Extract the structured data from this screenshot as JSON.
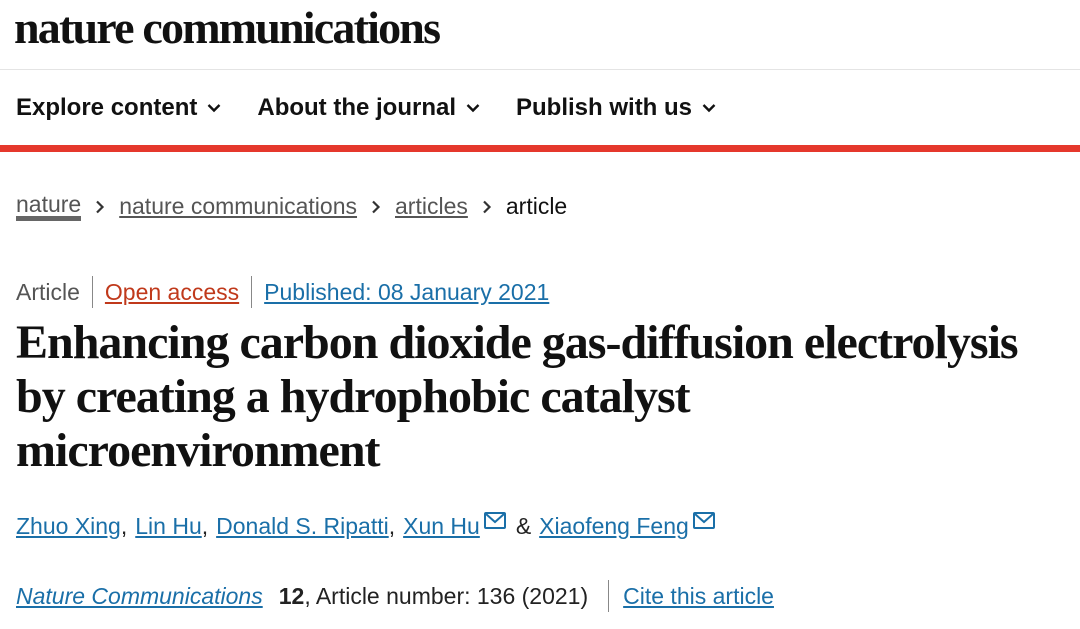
{
  "site": {
    "logo": "nature communications"
  },
  "nav": {
    "items": [
      {
        "label": "Explore content",
        "icon": "chevron-down-icon"
      },
      {
        "label": "About the journal",
        "icon": "chevron-down-icon"
      },
      {
        "label": "Publish with us",
        "icon": "chevron-down-icon"
      }
    ]
  },
  "breadcrumb": [
    "nature",
    "nature communications",
    "articles",
    "article"
  ],
  "meta": {
    "type": "Article",
    "access": "Open access",
    "published": "Published: 08 January 2021"
  },
  "article": {
    "title_lines": [
      "Enhancing carbon dioxide gas-diffusion electrolysis",
      "by creating a hydrophobic catalyst",
      "microenvironment"
    ],
    "authors": [
      "Zhuo Xing",
      "Lin Hu",
      "Donald S. Ripatti",
      "Xun Hu",
      "Xiaofeng Feng"
    ],
    "authors_sep": ",",
    "authors_amp": "&"
  },
  "citation": {
    "journal": "Nature Communications",
    "volume": "12",
    "details": ", Article number: 136 (2021)",
    "cite_label": "Cite this article"
  },
  "colors": {
    "accent_bar": "#e5382c",
    "link": "#1a6fa8",
    "open_access": "#c0391b"
  }
}
